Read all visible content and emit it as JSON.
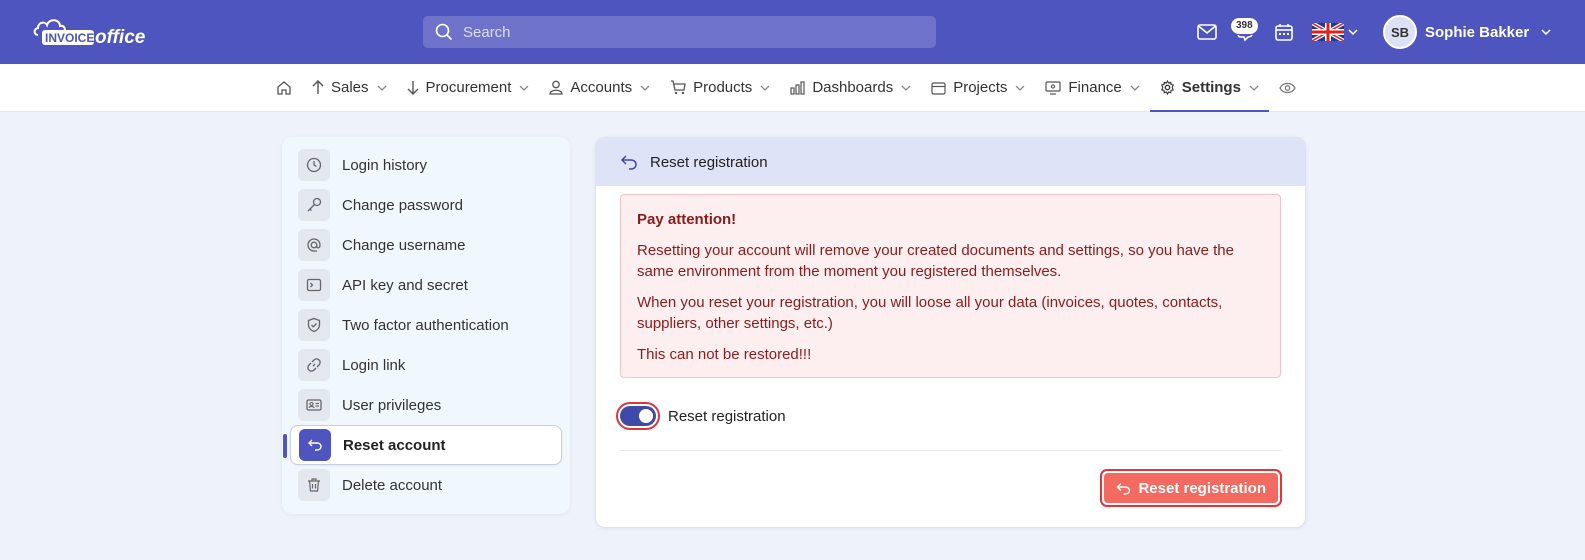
{
  "header": {
    "logo_text": "INVOICEoffice",
    "search_placeholder": "Search",
    "notification_count": "398",
    "user_initials": "SB",
    "user_name": "Sophie Bakker"
  },
  "nav": {
    "items": [
      {
        "label": "Sales",
        "icon": "arrow-up-icon"
      },
      {
        "label": "Procurement",
        "icon": "arrow-down-icon"
      },
      {
        "label": "Accounts",
        "icon": "user-icon"
      },
      {
        "label": "Products",
        "icon": "cart-icon"
      },
      {
        "label": "Dashboards",
        "icon": "bar-chart-icon"
      },
      {
        "label": "Projects",
        "icon": "calendar-icon"
      },
      {
        "label": "Finance",
        "icon": "monitor-icon"
      },
      {
        "label": "Settings",
        "icon": "gear-icon",
        "active": true
      }
    ]
  },
  "sidebar": {
    "items": [
      {
        "label": "Login history",
        "icon": "clock-icon"
      },
      {
        "label": "Change password",
        "icon": "key-icon"
      },
      {
        "label": "Change username",
        "icon": "at-icon"
      },
      {
        "label": "API key and secret",
        "icon": "terminal-icon"
      },
      {
        "label": "Two factor authentication",
        "icon": "shield-icon"
      },
      {
        "label": "Login link",
        "icon": "link-icon"
      },
      {
        "label": "User privileges",
        "icon": "id-card-icon"
      },
      {
        "label": "Reset account",
        "icon": "undo-icon",
        "active": true
      },
      {
        "label": "Delete account",
        "icon": "trash-icon"
      }
    ]
  },
  "panel": {
    "title": "Reset registration",
    "alert": {
      "title": "Pay attention!",
      "line1": "Resetting your account will remove your created documents and settings, so you have the same environment from the moment you registered themselves.",
      "line2": "When you reset your registration, you will loose all your data (invoices, quotes, contacts, suppliers, other settings, etc.)",
      "line3": "This can not be restored!!!"
    },
    "toggle_label": "Reset registration",
    "toggle_on": true,
    "button_label": "Reset registration"
  },
  "colors": {
    "brand": "#4f55be",
    "danger": "#f26a60",
    "alert_text": "#8a1c1c"
  }
}
